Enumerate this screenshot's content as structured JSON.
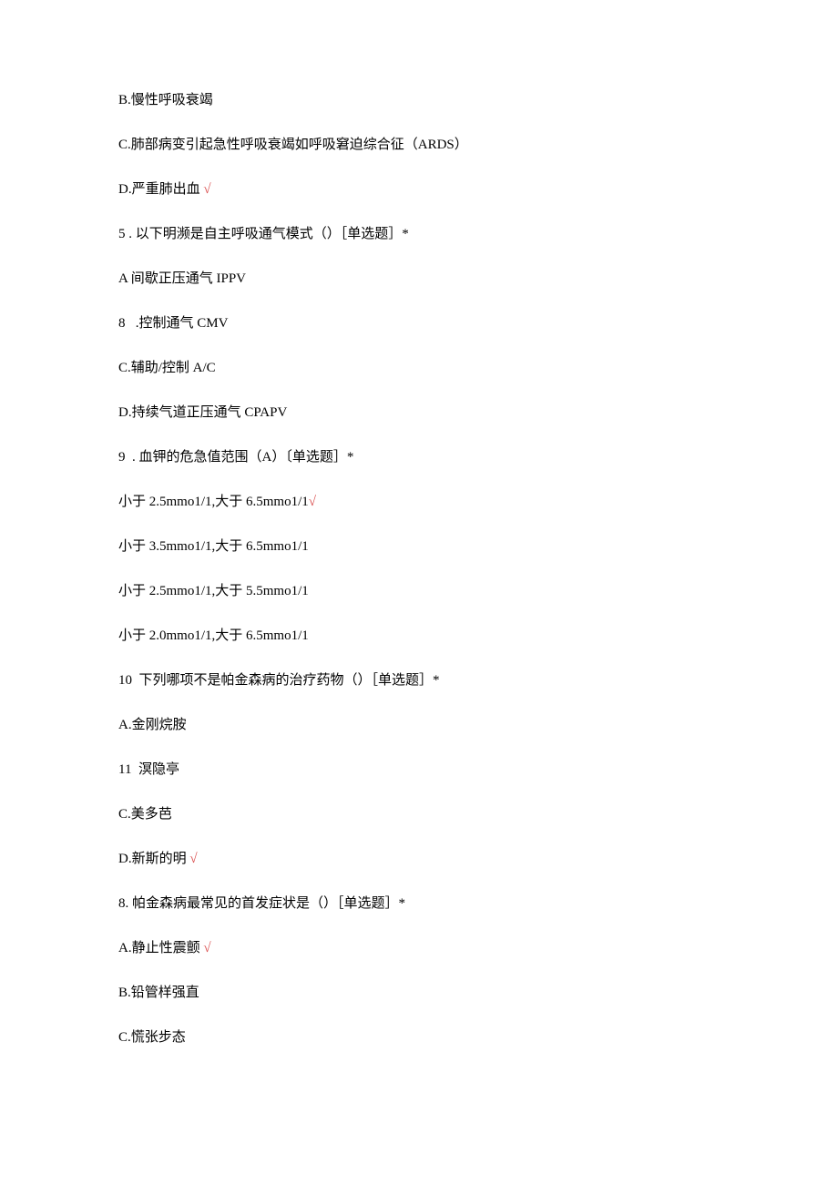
{
  "lines": [
    {
      "text": "B.慢性呼吸衰竭",
      "checked": false
    },
    {
      "text": "C.肺部病变引起急性呼吸衰竭如呼吸窘迫综合征（ARDS）",
      "checked": false
    },
    {
      "text": "D.严重肺出血 ",
      "checked": true
    },
    {
      "text": "5 . 以下明濒是自主呼吸通气模式（）［单选题］*",
      "checked": false
    },
    {
      "text": "A 间歇正压通气 IPPV",
      "checked": false
    },
    {
      "text": "8   .控制通气 CMV",
      "checked": false
    },
    {
      "text": "C.辅助/控制 A/C",
      "checked": false
    },
    {
      "text": "D.持续气道正压通气 CPAPV",
      "checked": false
    },
    {
      "text": "9  . 血钾的危急值范围（A）〔单选题］*",
      "checked": false
    },
    {
      "text": "小于 2.5mmo1/1,大于 6.5mmo1/1",
      "checked": true
    },
    {
      "text": "小于 3.5mmo1/1,大于 6.5mmo1/1",
      "checked": false
    },
    {
      "text": "小于 2.5mmo1/1,大于 5.5mmo1/1",
      "checked": false
    },
    {
      "text": "小于 2.0mmo1/1,大于 6.5mmo1/1",
      "checked": false
    },
    {
      "text": "10  下列哪项不是帕金森病的治疗药物（）［单选题］*",
      "checked": false
    },
    {
      "text": "A.金刚烷胺",
      "checked": false
    },
    {
      "text": "11  溟隐亭",
      "checked": false
    },
    {
      "text": "C.美多芭",
      "checked": false
    },
    {
      "text": "D.新斯的明 ",
      "checked": true
    },
    {
      "text": "8. 帕金森病最常见的首发症状是（）［单选题］*",
      "checked": false
    },
    {
      "text": "A.静止性震颤 ",
      "checked": true
    },
    {
      "text": "B.铅管样强直",
      "checked": false
    },
    {
      "text": "C.慌张步态",
      "checked": false
    }
  ],
  "checkmark": "√"
}
